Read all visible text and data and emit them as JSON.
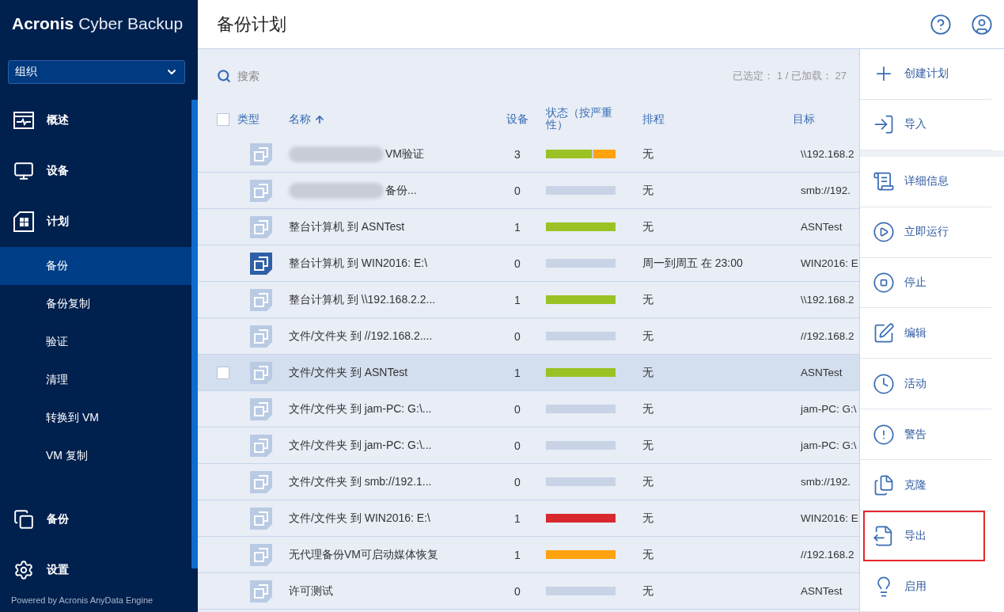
{
  "sidebar": {
    "brand": "Acronis",
    "product": "Cyber Backup",
    "org_select": {
      "value": "组织"
    },
    "items": [
      {
        "label": "概述",
        "kind": "overview",
        "selected": false
      },
      {
        "label": "设备",
        "kind": "devices",
        "selected": false
      },
      {
        "label": "计划",
        "kind": "plans",
        "selected": false,
        "children": [
          {
            "label": "备份",
            "selected": true
          },
          {
            "label": "备份复制",
            "selected": false
          },
          {
            "label": "验证",
            "selected": false
          },
          {
            "label": "清理",
            "selected": false
          },
          {
            "label": "转换到 VM",
            "selected": false
          },
          {
            "label": "VM 复制",
            "selected": false
          }
        ]
      },
      {
        "label": "备份",
        "kind": "backups",
        "selected": false
      },
      {
        "label": "设置",
        "kind": "settings",
        "selected": false
      }
    ],
    "footer": "Powered by Acronis AnyData Engine"
  },
  "header": {
    "title": "备份计划"
  },
  "toolbar": {
    "search_placeholder": "搜索",
    "counter": "已选定： 1 / 已加载： 27"
  },
  "table": {
    "columns": [
      "类型",
      "名称",
      "设备",
      "状态（按严重性）",
      "排程",
      "目标"
    ],
    "header_checked": false,
    "rows": [
      {
        "name": "VM验证",
        "redacted": true,
        "devices": "3",
        "status": [
          {
            "color": "#9bc225",
            "level": 0.67
          },
          {
            "color": "#ffa20d",
            "level": 0.33
          }
        ],
        "schedule": "无",
        "target": "\\\\192.168.2",
        "icon_active": false,
        "highlighted": false
      },
      {
        "name": "备份...",
        "redacted": true,
        "devices": "0",
        "schedule": "无",
        "target": "smb://192.",
        "icon_active": false,
        "highlighted": false
      },
      {
        "name": "整台计算机 到 ASNTest",
        "redacted": false,
        "devices": "1",
        "status": [
          {
            "color": "#9bc225",
            "level": 1
          }
        ],
        "schedule": "无",
        "target": "ASNTest",
        "icon_active": false,
        "highlighted": false
      },
      {
        "name": "整台计算机 到 WIN2016: E:\\",
        "redacted": false,
        "devices": "0",
        "schedule": "周一到周五 在 23:00",
        "target": "WIN2016: E",
        "icon_active": true,
        "highlighted": false
      },
      {
        "name": "整台计算机 到 \\\\192.168.2.2...",
        "redacted": false,
        "devices": "1",
        "status": [
          {
            "color": "#9bc225",
            "level": 1
          }
        ],
        "schedule": "无",
        "target": "\\\\192.168.2",
        "icon_active": false,
        "highlighted": false
      },
      {
        "name": "文件/文件夹 到 //192.168.2....",
        "redacted": false,
        "devices": "0",
        "schedule": "无",
        "target": "//192.168.2",
        "icon_active": false,
        "highlighted": false
      },
      {
        "name": "文件/文件夹 到 ASNTest",
        "redacted": false,
        "devices": "1",
        "status": [
          {
            "color": "#9bc225",
            "level": 1
          }
        ],
        "schedule": "无",
        "target": "ASNTest",
        "icon_active": false,
        "highlighted": true,
        "checked": false
      },
      {
        "name": "文件/文件夹 到 jam-PC: G:\\...",
        "redacted": false,
        "devices": "0",
        "schedule": "无",
        "target": "jam-PC: G:\\",
        "icon_active": false,
        "highlighted": false
      },
      {
        "name": "文件/文件夹 到 jam-PC: G:\\...",
        "redacted": false,
        "devices": "0",
        "schedule": "无",
        "target": "jam-PC: G:\\",
        "icon_active": false,
        "highlighted": false
      },
      {
        "name": "文件/文件夹 到 smb://192.1...",
        "redacted": false,
        "devices": "0",
        "schedule": "无",
        "target": "smb://192.",
        "icon_active": false,
        "highlighted": false
      },
      {
        "name": "文件/文件夹 到 WIN2016: E:\\",
        "redacted": false,
        "devices": "1",
        "status": [
          {
            "color": "#d9272e",
            "level": 1
          }
        ],
        "schedule": "无",
        "target": "WIN2016: E",
        "icon_active": false,
        "highlighted": false
      },
      {
        "name": "无代理备份VM可启动媒体恢复",
        "redacted": false,
        "devices": "1",
        "status": [
          {
            "color": "#ffa20d",
            "level": 1
          }
        ],
        "schedule": "无",
        "target": "//192.168.2",
        "icon_active": false,
        "highlighted": false
      },
      {
        "name": "许可测试",
        "redacted": false,
        "devices": "0",
        "schedule": "无",
        "target": "ASNTest",
        "icon_active": false,
        "highlighted": false
      }
    ]
  },
  "actions": [
    {
      "label": "创建计划",
      "kind": "create",
      "highlighted": false
    },
    {
      "label": "导入",
      "kind": "import",
      "highlighted": false
    },
    {
      "kind": "gap"
    },
    {
      "label": "详细信息",
      "kind": "details",
      "highlighted": false
    },
    {
      "label": "立即运行",
      "kind": "run",
      "highlighted": false
    },
    {
      "label": "停止",
      "kind": "stop",
      "highlighted": false
    },
    {
      "label": "编辑",
      "kind": "edit",
      "highlighted": false
    },
    {
      "label": "活动",
      "kind": "activity",
      "highlighted": false
    },
    {
      "label": "警告",
      "kind": "alerts",
      "highlighted": false
    },
    {
      "label": "克隆",
      "kind": "clone",
      "highlighted": false
    },
    {
      "label": "导出",
      "kind": "export",
      "highlighted": true
    },
    {
      "label": "启用",
      "kind": "enable",
      "highlighted": false
    }
  ]
}
